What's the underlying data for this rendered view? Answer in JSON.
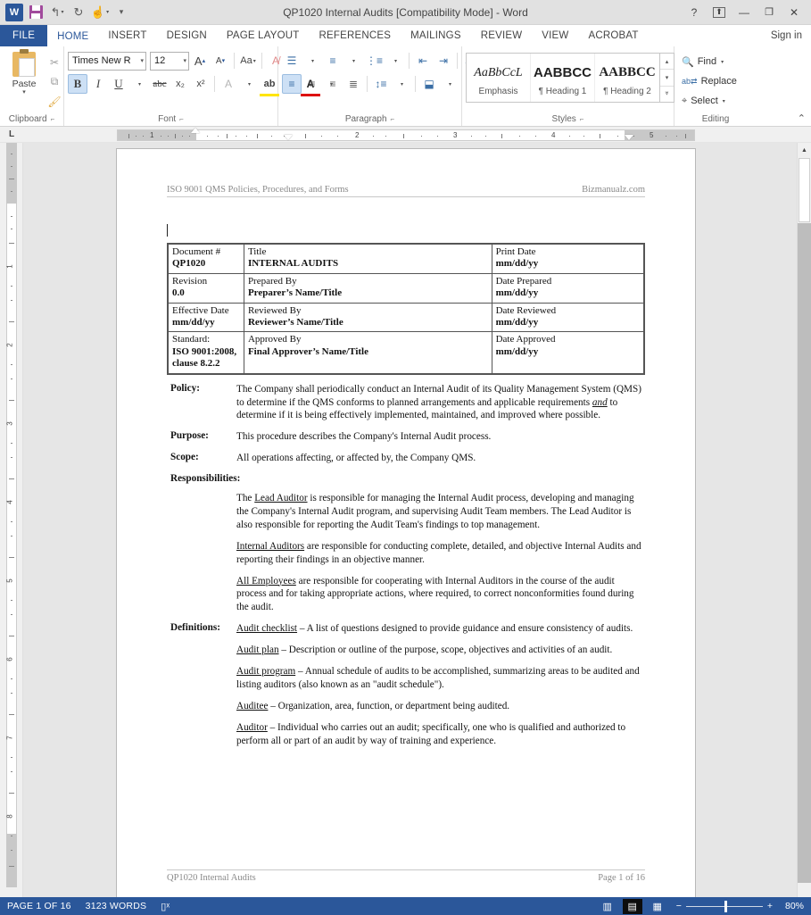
{
  "titlebar": {
    "app_icon": "word-logo",
    "quick_access": [
      {
        "name": "save",
        "glyph": "save-icon"
      },
      {
        "name": "undo",
        "glyph": "↰"
      },
      {
        "name": "redo",
        "glyph": "↻"
      },
      {
        "name": "touch-mode",
        "glyph": "✋"
      },
      {
        "name": "customize-qat",
        "glyph": "▾"
      }
    ],
    "title": "QP1020 Internal Audits [Compatibility Mode] - Word",
    "help_label": "?",
    "ribbon_display_label": "⬆",
    "minimize_label": "—",
    "restore_label": "❐",
    "close_label": "✕"
  },
  "tabs": {
    "file": "FILE",
    "items": [
      "HOME",
      "INSERT",
      "DESIGN",
      "PAGE LAYOUT",
      "REFERENCES",
      "MAILINGS",
      "REVIEW",
      "VIEW",
      "ACROBAT"
    ],
    "active": "HOME",
    "signin": "Sign in"
  },
  "ribbon": {
    "groups": [
      {
        "name": "Clipboard",
        "label": "Clipboard"
      },
      {
        "name": "Font",
        "label": "Font"
      },
      {
        "name": "Paragraph",
        "label": "Paragraph"
      },
      {
        "name": "Styles",
        "label": "Styles"
      },
      {
        "name": "Editing",
        "label": "Editing"
      }
    ],
    "clipboard": {
      "paste_label": "Paste",
      "paste_arrow": "▾",
      "cut_label": "✂",
      "copy_label": "⧉",
      "format_painter_label": "🖌"
    },
    "font": {
      "font_name": "Times New R",
      "font_size": "12",
      "grow_font": "A",
      "shrink_font": "A",
      "change_case": "Aa",
      "clear_formatting": "A",
      "bold": "B",
      "italic": "I",
      "underline": "U",
      "strikethrough": "abc",
      "subscript": "x₂",
      "superscript": "x²",
      "text_effects": "A",
      "highlight": "ab",
      "font_color": "A"
    },
    "paragraph": {
      "bullets": "•≡",
      "numbering": "1≡",
      "multilevel": "⁎≡",
      "decrease_indent": "⇤",
      "increase_indent": "⇥",
      "sort": "A↓",
      "show_marks": "¶",
      "align_left": "≡",
      "align_center": "≡",
      "align_right": "≡",
      "justify": "≡",
      "line_spacing": "↕≡",
      "shading": "▨",
      "borders": "⊞"
    },
    "styles": {
      "items": [
        {
          "preview": "AaBbCcL",
          "name": "Emphasis"
        },
        {
          "preview": "AABBCC",
          "name": "¶ Heading 1"
        },
        {
          "preview": "AABBCC",
          "name": "¶ Heading 2"
        }
      ],
      "scroll_up": "▴",
      "scroll_down": "▾",
      "more": "▾"
    },
    "editing": {
      "find": "Find",
      "replace": "Replace",
      "select": "Select",
      "find_icon": "binoculars-icon",
      "replace_icon": "ab-replace-icon",
      "select_icon": "cursor-select-icon"
    },
    "collapse_label": "⌃"
  },
  "ruler": {
    "corner_label": "L",
    "h_marks": [
      "1",
      "2",
      "3",
      "4",
      "5"
    ],
    "v_marks": [
      "1",
      "2",
      "3",
      "4",
      "5",
      "6",
      "7",
      "8"
    ]
  },
  "document": {
    "header_left": "ISO 9001 QMS Policies, Procedures, and Forms",
    "header_right": "Bizmanualz.com",
    "footer_left": "QP1020 Internal Audits",
    "footer_right": "Page 1 of 16",
    "table": [
      {
        "c1_label": "Document #",
        "c1_value": "QP1020",
        "c2_label": "Title",
        "c2_value": "INTERNAL AUDITS",
        "c3_label": "Print Date",
        "c3_value": "mm/dd/yy"
      },
      {
        "c1_label": "Revision",
        "c1_value": "0.0",
        "c2_label": "Prepared By",
        "c2_value": "Preparer’s Name/Title",
        "c3_label": "Date Prepared",
        "c3_value": "mm/dd/yy"
      },
      {
        "c1_label": "Effective Date",
        "c1_value": "mm/dd/yy",
        "c2_label": "Reviewed By",
        "c2_value": "Reviewer’s Name/Title",
        "c3_label": "Date Reviewed",
        "c3_value": "mm/dd/yy"
      },
      {
        "c1_label": "Standard:",
        "c1_value": "ISO 9001:2008, clause 8.2.2",
        "c2_label": "Approved By",
        "c2_value": "Final Approver’s Name/Title",
        "c3_label": "Date Approved",
        "c3_value": "mm/dd/yy"
      }
    ],
    "sections": {
      "policy_label": "Policy:",
      "policy_text_1": "The Company shall periodically conduct an Internal Audit of its Quality Management System (QMS) to determine if the QMS conforms to planned arrangements and applicable requirements ",
      "policy_emph": "and",
      "policy_text_2": " to determine if it is being effectively implemented, maintained, and improved where possible.",
      "purpose_label": "Purpose:",
      "purpose_text": "This procedure describes the Company's Internal Audit process.",
      "scope_label": "Scope:",
      "scope_text": "All operations affecting, or affected by, the Company QMS.",
      "responsibilities_label": "Responsibilities:",
      "resp_1_term": "Lead Auditor",
      "resp_1_pre": "The ",
      "resp_1_text": " is responsible for managing the Internal Audit process, developing and managing the Company's Internal Audit program, and supervising Audit Team members.  The Lead Auditor is also responsible for reporting the Audit Team's findings to top management.",
      "resp_2_term": "Internal Auditors",
      "resp_2_text": " are responsible for conducting complete, detailed, and objective Internal Audits and reporting their findings in an objective manner.",
      "resp_3_term": "All Employees",
      "resp_3_text": " are responsible for cooperating with Internal Auditors in the course of the audit process and for taking appropriate actions, where required, to correct nonconformities found during the audit.",
      "definitions_label": "Definitions:",
      "def_1_term": "Audit checklist",
      "def_1_text": " – A list of questions designed to provide guidance and ensure consistency of audits.",
      "def_2_term": "Audit plan",
      "def_2_text": " – Description or outline of the purpose, scope, objectives and activities of an audit.",
      "def_3_term": "Audit program",
      "def_3_text": " – Annual schedule of audits to be accomplished, summarizing areas to be audited and listing auditors (also known as an \"audit schedule\").",
      "def_4_term": "Auditee",
      "def_4_text": " – Organization, area, function, or department being audited.",
      "def_5_term": "Auditor",
      "def_5_text": " – Individual who carries out an audit; specifically, one who is qualified and authorized to perform all or part of an audit by way of training and experience."
    }
  },
  "statusbar": {
    "page_info": "PAGE 1 OF 16",
    "word_count": "3123 WORDS",
    "proofing_icon": "proofing-errors-icon",
    "view_read": "read-mode-icon",
    "view_print": "print-layout-icon",
    "view_web": "web-layout-icon",
    "zoom_out": "−",
    "zoom_in": "+",
    "zoom_level": "80%"
  },
  "colors": {
    "accent": "#2b579a",
    "ribbon_bg": "#ffffff",
    "workspace_bg": "#e6e6e6",
    "status_bg": "#2b579a"
  }
}
